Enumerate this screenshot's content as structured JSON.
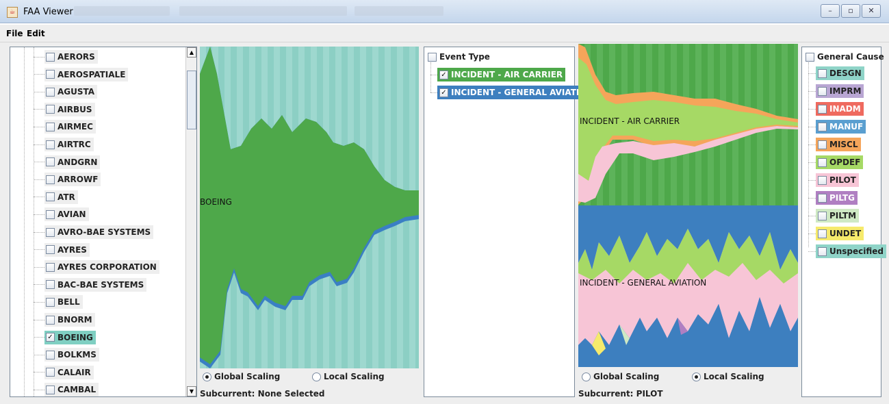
{
  "window": {
    "title": "FAA Viewer",
    "icon": "java-cup-icon",
    "controls": [
      "minimize",
      "maximize",
      "close"
    ]
  },
  "menubar": {
    "file": "File",
    "edit": "Edit"
  },
  "manufacturers": [
    {
      "label": "AERORS",
      "checked": false
    },
    {
      "label": "AEROSPATIALE",
      "checked": false
    },
    {
      "label": "AGUSTA",
      "checked": false
    },
    {
      "label": "AIRBUS",
      "checked": false
    },
    {
      "label": "AIRMEC",
      "checked": false
    },
    {
      "label": "AIRTRC",
      "checked": false
    },
    {
      "label": "ANDGRN",
      "checked": false
    },
    {
      "label": "ARROWF",
      "checked": false
    },
    {
      "label": "ATR",
      "checked": false
    },
    {
      "label": "AVIAN",
      "checked": false
    },
    {
      "label": "AVRO-BAE SYSTEMS",
      "checked": false
    },
    {
      "label": "AYRES",
      "checked": false
    },
    {
      "label": "AYRES CORPORATION",
      "checked": false
    },
    {
      "label": "BAC-BAE SYSTEMS",
      "checked": false
    },
    {
      "label": "BELL",
      "checked": false
    },
    {
      "label": "BNORM",
      "checked": false
    },
    {
      "label": "BOEING",
      "checked": true
    },
    {
      "label": "BOLKMS",
      "checked": false
    },
    {
      "label": "CALAIR",
      "checked": false
    },
    {
      "label": "CAMBAL",
      "checked": false
    }
  ],
  "left_graph": {
    "label": "BOEING",
    "scaling": {
      "global": "Global Scaling",
      "local": "Local Scaling",
      "selected": "global"
    },
    "subcurrent": "Subcurrent: None Selected"
  },
  "event_types": {
    "root": "Event Type",
    "items": [
      {
        "label": "INCIDENT - AIR CARRIER",
        "checked": true,
        "color": "#4ea84a"
      },
      {
        "label": "INCIDENT - GENERAL AVIATION",
        "checked": true,
        "color": "#3d7fbf"
      }
    ]
  },
  "right_graph": {
    "labels": [
      "INCIDENT - AIR CARRIER",
      "INCIDENT - GENERAL AVIATION"
    ],
    "scaling": {
      "global": "Global Scaling",
      "local": "Local Scaling",
      "selected": "local"
    },
    "subcurrent": "Subcurrent: PILOT"
  },
  "causes": {
    "root": "General Cause",
    "items": [
      {
        "label": "DESGN",
        "color": "#8fd4c8"
      },
      {
        "label": "IMPRM",
        "color": "#b9a6d3"
      },
      {
        "label": "INADM",
        "color": "#ef6a5f"
      },
      {
        "label": "MANUF",
        "color": "#5a9fd0"
      },
      {
        "label": "MISCL",
        "color": "#f5a55a"
      },
      {
        "label": "OPDEF",
        "color": "#a6d965"
      },
      {
        "label": "PILOT",
        "color": "#f7c5d6"
      },
      {
        "label": "PILTG",
        "color": "#b07fc2"
      },
      {
        "label": "PILTM",
        "color": "#cfe9c4"
      },
      {
        "label": "UNDET",
        "color": "#f6ea6c"
      },
      {
        "label": "Unspecified",
        "color": "#8fd4c8"
      }
    ]
  }
}
